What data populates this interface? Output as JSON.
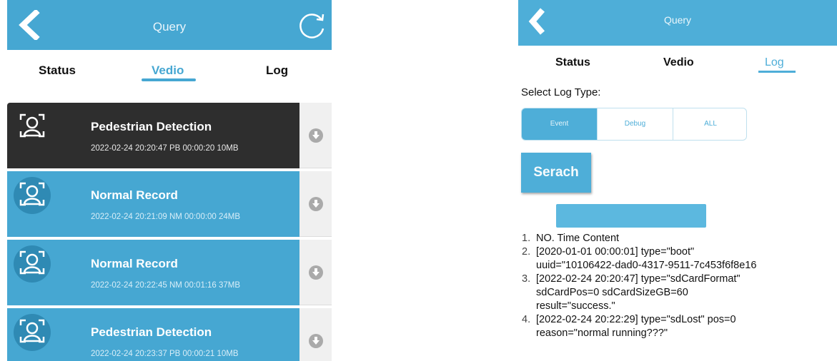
{
  "colors": {
    "accent": "#46a7d2",
    "dark_row": "#2e2e2e",
    "side_bg": "#f0f0f0"
  },
  "left": {
    "header": {
      "title": "Query"
    },
    "tabs": [
      {
        "label": "Status",
        "active": false
      },
      {
        "label": "Vedio",
        "active": true
      },
      {
        "label": "Log",
        "active": false
      }
    ],
    "items": [
      {
        "name": "Pedestrian Detection",
        "meta": "2022-02-24 20:20:47 PB 00:00:20 10MB",
        "selected": true
      },
      {
        "name": "Normal Record",
        "meta": "2022-02-24 20:21:09 NM 00:00:00 24MB",
        "selected": false
      },
      {
        "name": "Normal Record",
        "meta": "2022-02-24 20:22:45 NM 00:01:16 37MB",
        "selected": false
      },
      {
        "name": "Pedestrian Detection",
        "meta": "2022-02-24 20:23:37 PB 00:00:21 10MB",
        "selected": false
      }
    ]
  },
  "right": {
    "header": {
      "title": "Query"
    },
    "tabs": [
      {
        "label": "Status",
        "active": false
      },
      {
        "label": "Vedio",
        "active": false
      },
      {
        "label": "Log",
        "active": true
      }
    ],
    "select_label": "Select Log Type:",
    "log_types": [
      {
        "label": "Event",
        "selected": true
      },
      {
        "label": "Debug",
        "selected": false
      },
      {
        "label": "ALL",
        "selected": false
      }
    ],
    "search_label": "Serach",
    "log_lines": [
      {
        "num": "1.",
        "lines": [
          "NO.  Time  Content"
        ]
      },
      {
        "num": "2.",
        "lines": [
          "[2020-01-01 00:00:01] type=\"boot\"",
          "uuid=\"10106422-dad0-4317-9511-7c453f6f8e16"
        ]
      },
      {
        "num": "3.",
        "lines": [
          "[2022-02-24 20:20:47] type=\"sdCardFormat\"",
          "sdCardPos=0 sdCardSizeGB=60",
          "result=\"success.\""
        ]
      },
      {
        "num": "4.",
        "lines": [
          "[2022-02-24 20:22:29] type=\"sdLost\" pos=0",
          "reason=\"normal running???\""
        ]
      }
    ]
  }
}
